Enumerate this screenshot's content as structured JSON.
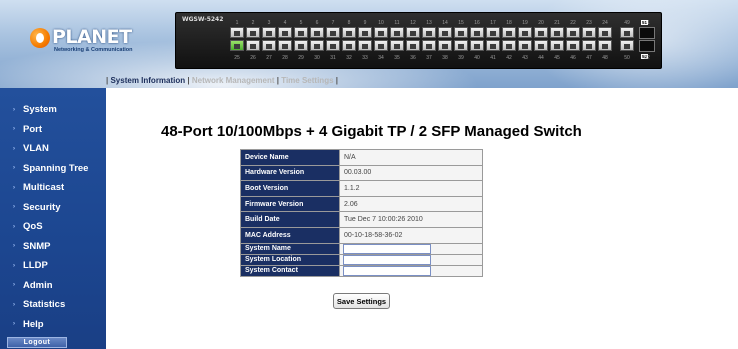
{
  "header": {
    "logo_text": "PLANET",
    "logo_subtext": "Networking & Communication",
    "switch_model": "WGSW-5242",
    "port_top_numbers": [
      "1",
      "2",
      "3",
      "4",
      "5",
      "6",
      "7",
      "8",
      "9",
      "10",
      "11",
      "12",
      "13",
      "14",
      "15",
      "16",
      "17",
      "18",
      "19",
      "20",
      "21",
      "22",
      "23",
      "24",
      "49",
      "51"
    ],
    "port_bottom_numbers": [
      "25",
      "26",
      "27",
      "28",
      "29",
      "30",
      "31",
      "32",
      "33",
      "34",
      "35",
      "36",
      "37",
      "38",
      "39",
      "40",
      "41",
      "42",
      "43",
      "44",
      "45",
      "46",
      "47",
      "48",
      "50",
      "52"
    ],
    "sfp_top_tag": "51",
    "sfp_bottom_tag": "52"
  },
  "tabs": [
    {
      "label": "System Information",
      "active": true
    },
    {
      "label": "Network Management",
      "active": false
    },
    {
      "label": "Time Settings",
      "active": false
    }
  ],
  "sidebar": {
    "items": [
      {
        "label": "System"
      },
      {
        "label": "Port"
      },
      {
        "label": "VLAN"
      },
      {
        "label": "Spanning Tree"
      },
      {
        "label": "Multicast"
      },
      {
        "label": "Security"
      },
      {
        "label": "QoS"
      },
      {
        "label": "SNMP"
      },
      {
        "label": "LLDP"
      },
      {
        "label": "Admin"
      },
      {
        "label": "Statistics"
      },
      {
        "label": "Help"
      }
    ],
    "logout_label": "Logout"
  },
  "main": {
    "title": "48-Port 10/100Mbps + 4 Gigabit TP / 2 SFP Managed Switch",
    "info_rows": [
      {
        "label": "Device Name",
        "value": "N/A"
      },
      {
        "label": "Hardware Version",
        "value": "00.03.00"
      },
      {
        "label": "Boot Version",
        "value": "1.1.2"
      },
      {
        "label": "Firmware Version",
        "value": "2.06"
      },
      {
        "label": "Build Date",
        "value": "Tue Dec 7 10:00:26 2010"
      },
      {
        "label": "MAC Address",
        "value": "00-10-18-58-36-02"
      }
    ],
    "input_rows": [
      {
        "label": "System Name",
        "value": ""
      },
      {
        "label": "System Location",
        "value": ""
      },
      {
        "label": "System Contact",
        "value": ""
      }
    ],
    "save_label": "Save Settings"
  }
}
